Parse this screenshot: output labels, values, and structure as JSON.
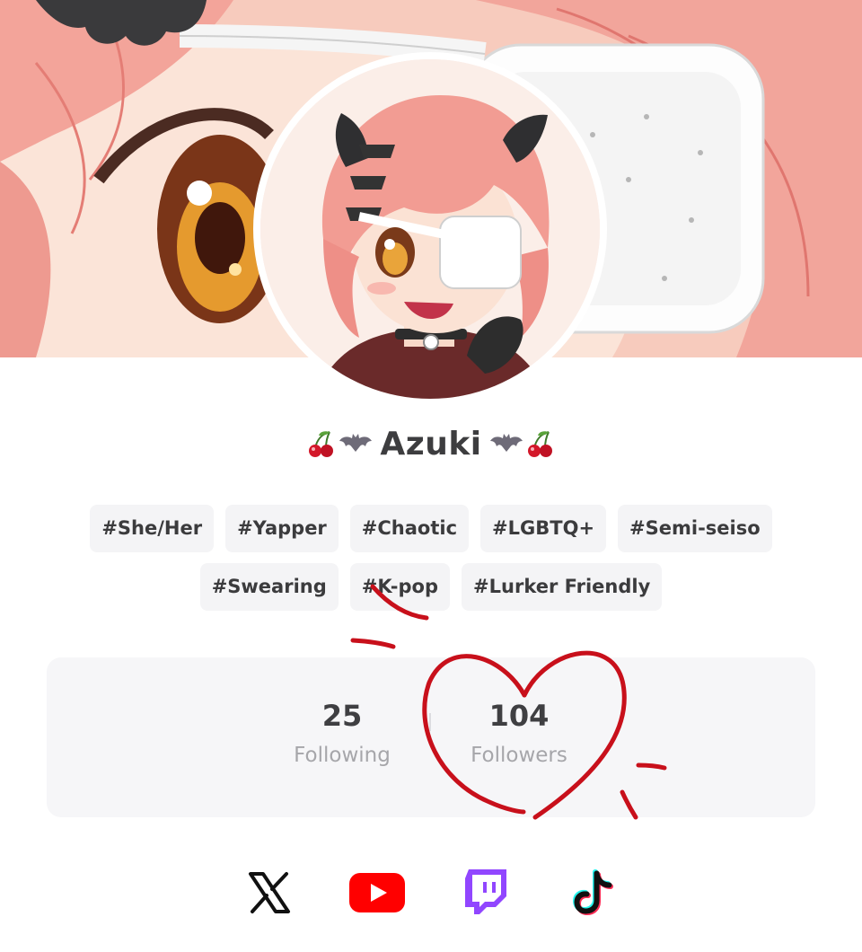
{
  "profile": {
    "display_name": "Azuki",
    "name_decor_left": [
      "cherry-icon",
      "bat-icon"
    ],
    "name_decor_right": [
      "bat-icon",
      "cherry-icon"
    ]
  },
  "tags": [
    "#She/Her",
    "#Yapper",
    "#Chaotic",
    "#LGBTQ+",
    "#Semi-seiso",
    "#Swearing",
    "#K-pop",
    "#Lurker Friendly"
  ],
  "stats": {
    "following_value": "25",
    "following_label": "Following",
    "followers_value": "104",
    "followers_label": "Followers"
  },
  "social_links": [
    "x-icon",
    "youtube-icon",
    "twitch-icon",
    "tiktok-icon"
  ],
  "colors": {
    "hair": "#f2a59b",
    "annotation_red": "#c8101b",
    "tag_bg": "#f4f4f6",
    "stats_bg": "#f6f6f8",
    "youtube": "#ff0000",
    "twitch": "#9146ff"
  }
}
